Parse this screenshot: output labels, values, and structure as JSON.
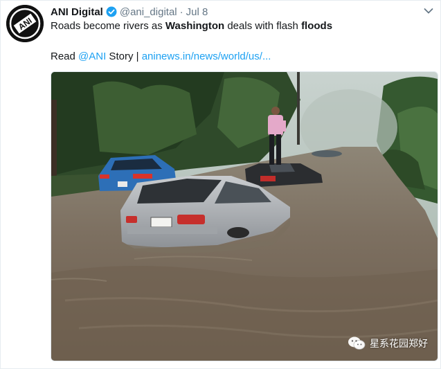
{
  "tweet": {
    "display_name": "ANI Digital",
    "handle": "@ani_digital",
    "separator": "·",
    "date": "Jul 8",
    "text": {
      "part1": "Roads become rivers as ",
      "bold1": "Washington",
      "part2": " deals with flash ",
      "bold2": "floods"
    },
    "read": {
      "prefix": "Read ",
      "mention": "@ANI",
      "middle": " Story | ",
      "url": "aninews.in/news/world/us/..."
    },
    "avatar_text": "ANI"
  },
  "watermark": {
    "text": "星系花园郑好"
  },
  "colors": {
    "link": "#1da1f2",
    "secondary": "#657786",
    "verified": "#1da1f2"
  }
}
